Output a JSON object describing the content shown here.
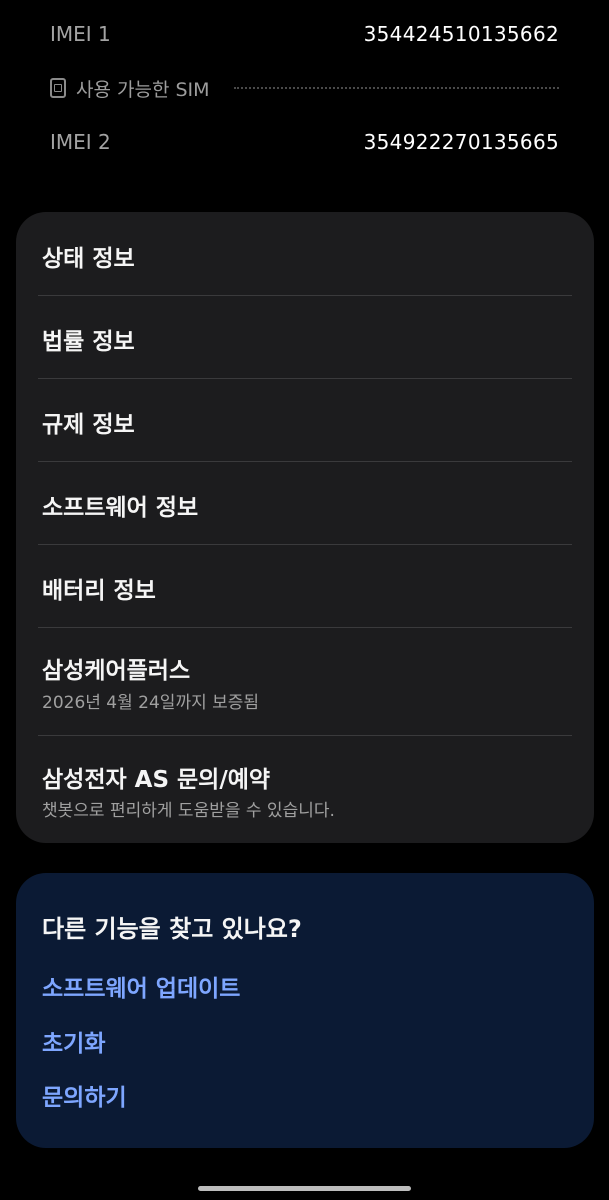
{
  "imei": {
    "imei1_label": "IMEI 1",
    "imei1_value": "354424510135662",
    "sim_label": "사용 가능한 SIM",
    "sim_icon": "sim-card-icon",
    "imei2_label": "IMEI 2",
    "imei2_value": "354922270135665"
  },
  "menu": {
    "items": [
      {
        "title": "상태 정보"
      },
      {
        "title": "법률 정보"
      },
      {
        "title": "규제 정보"
      },
      {
        "title": "소프트웨어 정보"
      },
      {
        "title": "배터리 정보"
      },
      {
        "title": "삼성케어플러스",
        "subtitle": "2026년 4월 24일까지 보증됨"
      },
      {
        "title": "삼성전자 AS 문의/예약",
        "subtitle": "챗봇으로 편리하게 도움받을 수 있습니다."
      }
    ]
  },
  "find": {
    "title": "다른 기능을 찾고 있나요?",
    "links": [
      "소프트웨어 업데이트",
      "초기화",
      "문의하기"
    ]
  },
  "colors": {
    "background": "#000000",
    "card": "#1c1c1e",
    "find_card": "#0b1a34",
    "link": "#7ea6ff"
  }
}
